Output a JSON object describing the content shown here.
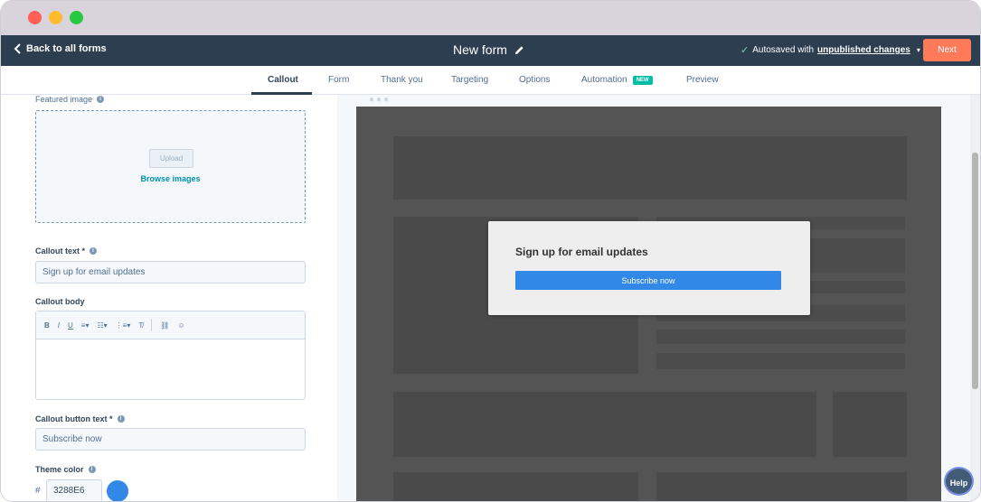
{
  "header": {
    "back_label": "Back to all forms",
    "form_title": "New form",
    "autosave_prefix": "Autosaved with",
    "autosave_link": "unpublished changes",
    "next_label": "Next"
  },
  "tabs": [
    {
      "label": "Callout"
    },
    {
      "label": "Form"
    },
    {
      "label": "Thank you"
    },
    {
      "label": "Targeting"
    },
    {
      "label": "Options"
    },
    {
      "label": "Automation",
      "badge": "NEW"
    },
    {
      "label": "Preview"
    }
  ],
  "editor": {
    "featured_image_label": "Featured image",
    "upload_label": "Upload",
    "browse_label": "Browse images",
    "callout_text_label": "Callout text *",
    "callout_text_value": "Sign up for email updates",
    "callout_body_label": "Callout body",
    "toolbar": {
      "bold": "B",
      "italic": "I",
      "underline": "U",
      "clear": "T̸"
    },
    "button_text_label": "Callout button text *",
    "button_text_value": "Subscribe now",
    "theme_color_label": "Theme color",
    "hash_symbol": "#",
    "theme_color_value": "3288E6"
  },
  "preview": {
    "popup_title": "Sign up for email updates",
    "popup_button": "Subscribe now"
  },
  "help_label": "Help",
  "colors": {
    "accent": "#ff7a59",
    "theme": "#3288E6",
    "nav_bg": "#2d3e50"
  }
}
